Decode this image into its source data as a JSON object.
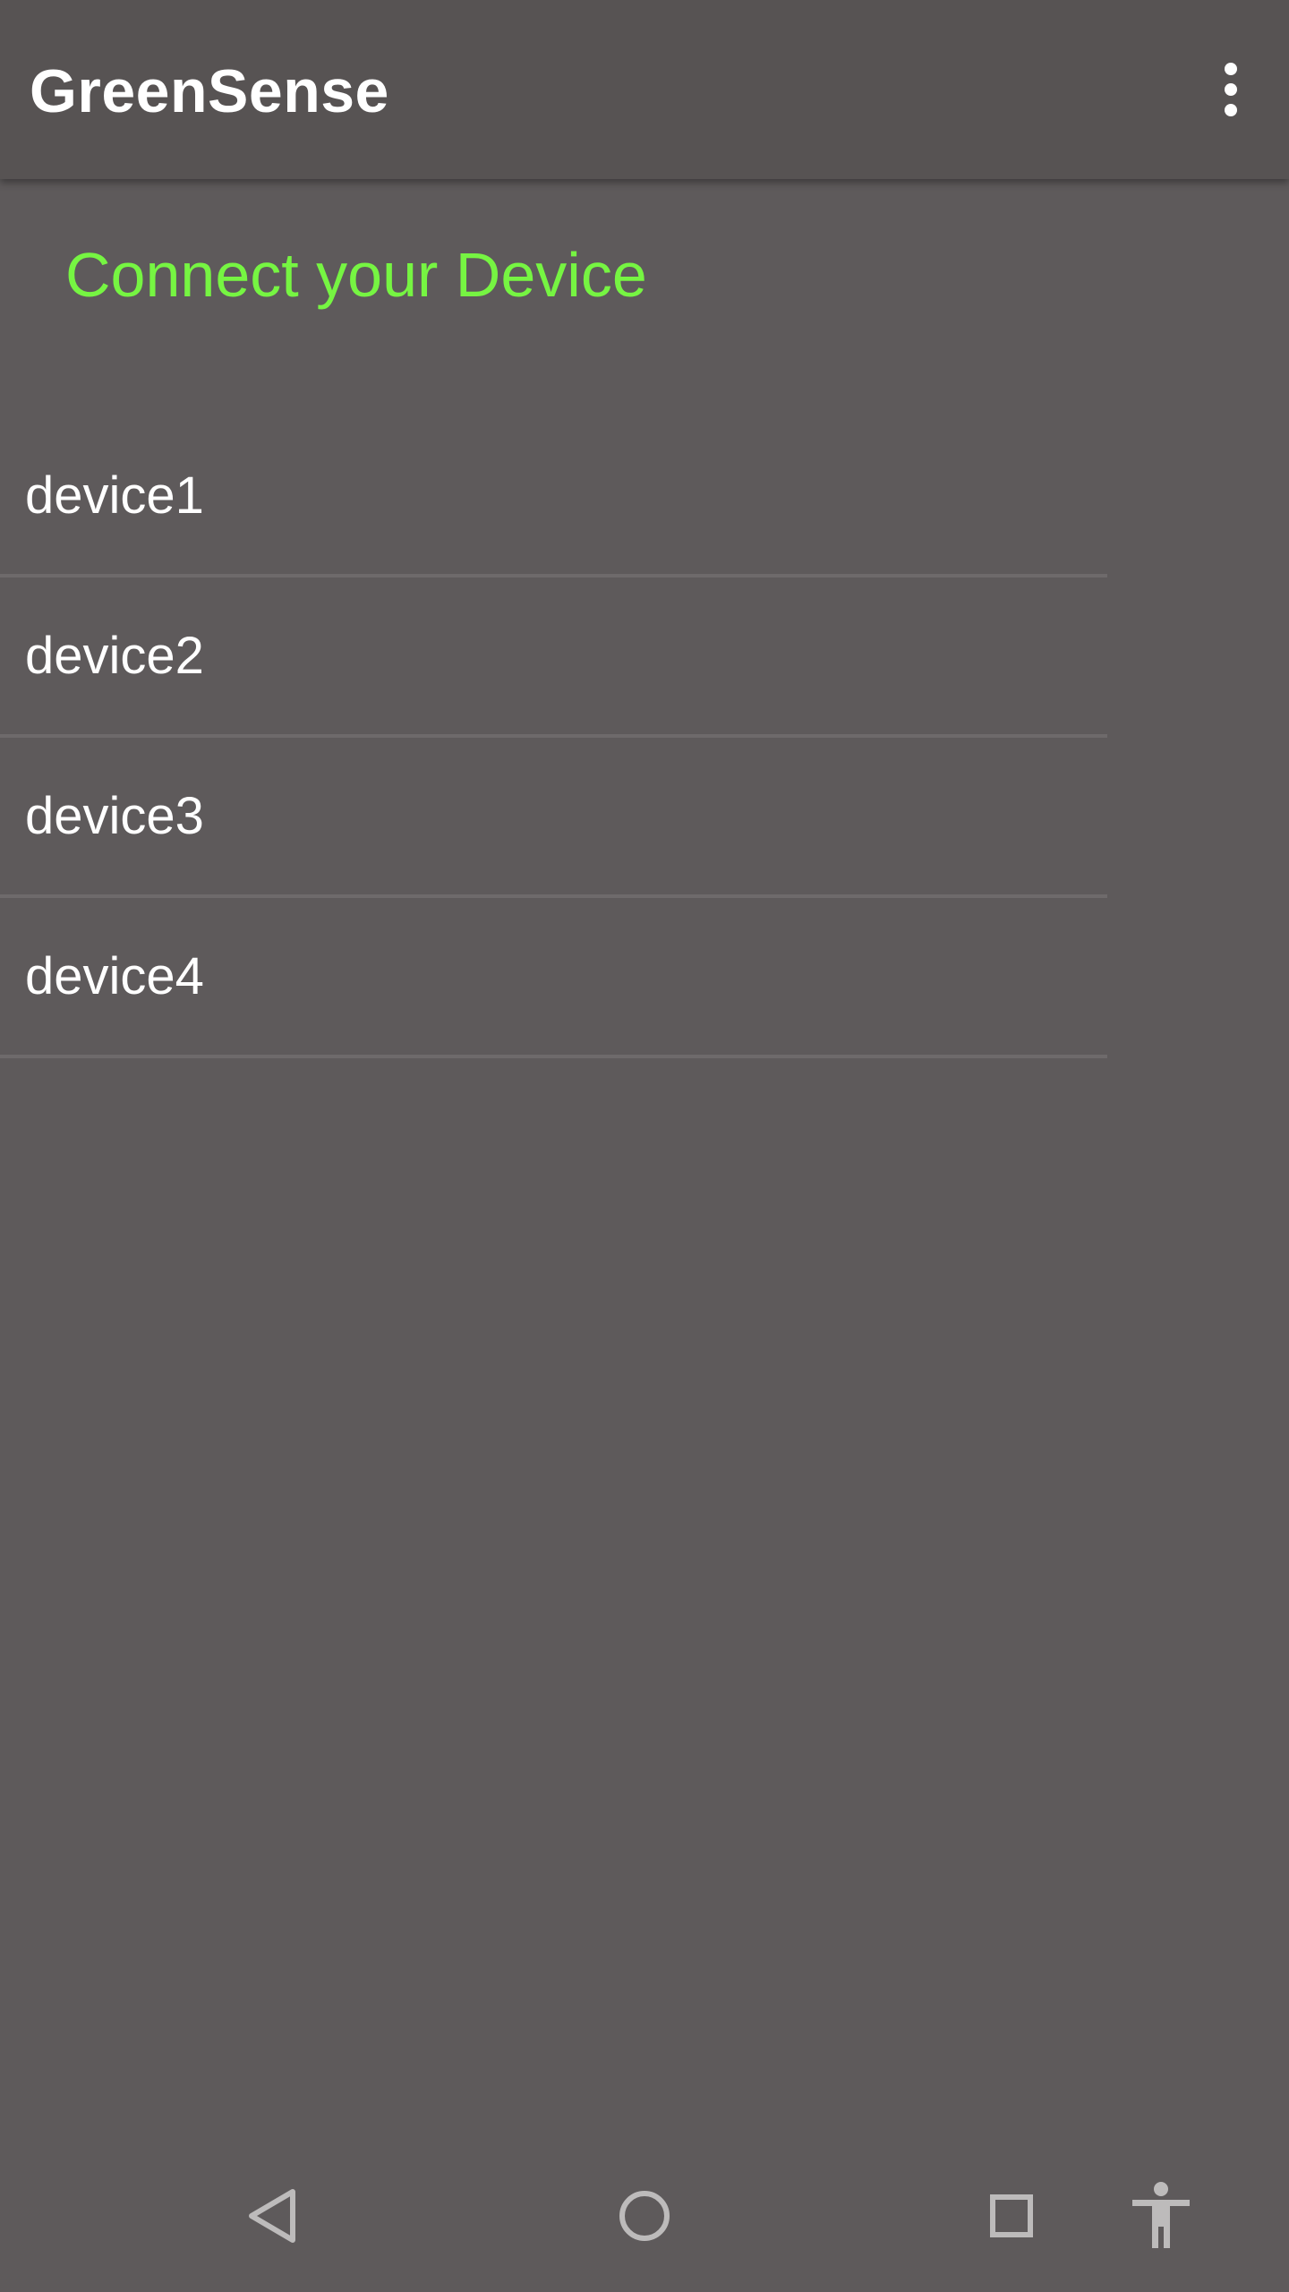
{
  "app_bar": {
    "title": "GreenSense",
    "overflow_icon": "more-vert-icon"
  },
  "main": {
    "heading": "Connect your Device",
    "heading_color": "#76f542",
    "devices": [
      {
        "label": "device1"
      },
      {
        "label": "device2"
      },
      {
        "label": "device3"
      },
      {
        "label": "device4"
      }
    ]
  },
  "nav_bar": {
    "back_icon": "back-triangle-icon",
    "home_icon": "home-circle-icon",
    "recents_icon": "recents-square-icon",
    "accessibility_icon": "accessibility-icon"
  }
}
